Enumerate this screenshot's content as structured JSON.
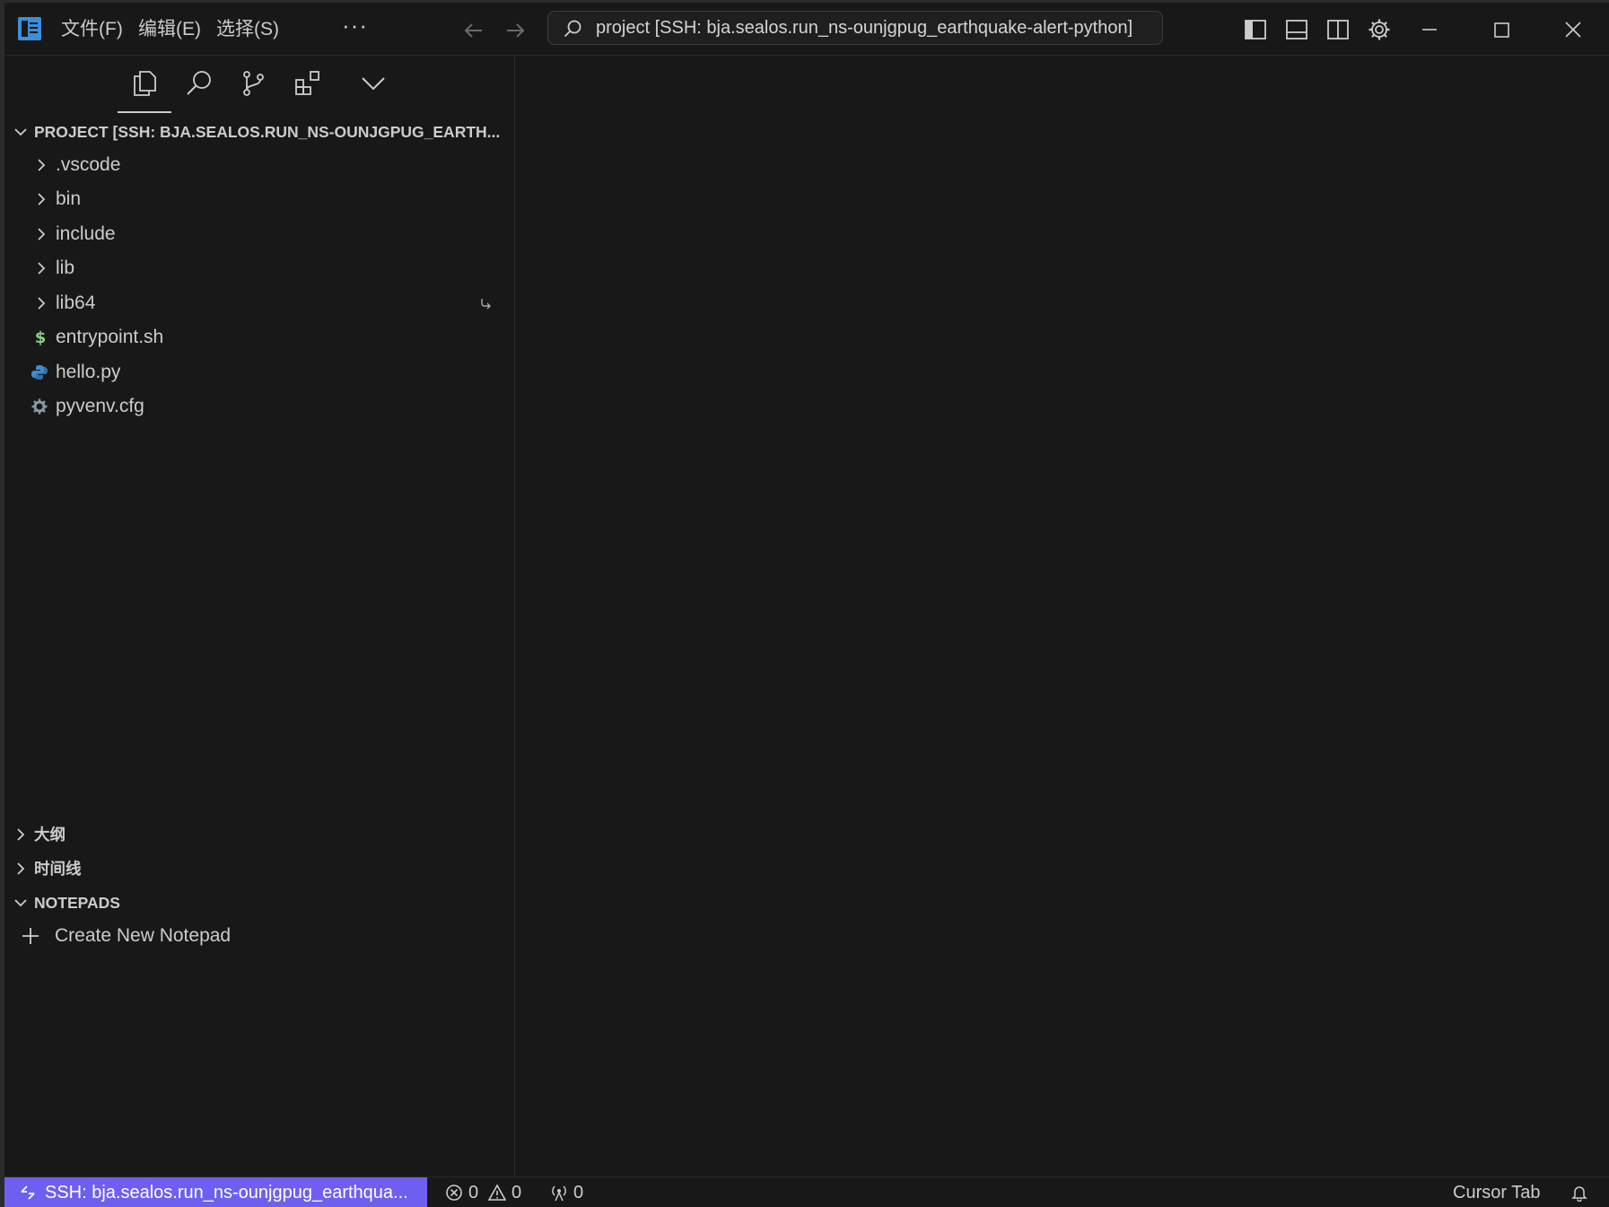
{
  "menu": {
    "file": "文件(F)",
    "edit": "编辑(E)",
    "select": "选择(S)",
    "more": "···"
  },
  "search": {
    "text": "project [SSH: bja.sealos.run_ns-ounjgpug_earthquake-alert-python]"
  },
  "explorer": {
    "header": "PROJECT [SSH: BJA.SEALOS.RUN_NS-OUNJGPUG_EARTH...",
    "items": [
      {
        "name": ".vscode",
        "type": "folder"
      },
      {
        "name": "bin",
        "type": "folder"
      },
      {
        "name": "include",
        "type": "folder"
      },
      {
        "name": "lib",
        "type": "folder"
      },
      {
        "name": "lib64",
        "type": "folder-symlink"
      },
      {
        "name": "entrypoint.sh",
        "type": "shell-file"
      },
      {
        "name": "hello.py",
        "type": "python-file"
      },
      {
        "name": "pyvenv.cfg",
        "type": "config-file"
      }
    ]
  },
  "sections": {
    "outline": "大纲",
    "timeline": "时间线",
    "notepads": "NOTEPADS",
    "create_notepad": "Create New Notepad"
  },
  "statusbar": {
    "remote": "SSH: bja.sealos.run_ns-ounjgpug_earthqua...",
    "errors": "0",
    "warnings": "0",
    "ports": "0",
    "cursor_tab": "Cursor Tab"
  },
  "colors": {
    "background": "#181818",
    "remote_accent": "#6e5ff0",
    "shell_icon": "#89d185",
    "python_icon": "#3b8fd6",
    "text": "#cccccc"
  }
}
